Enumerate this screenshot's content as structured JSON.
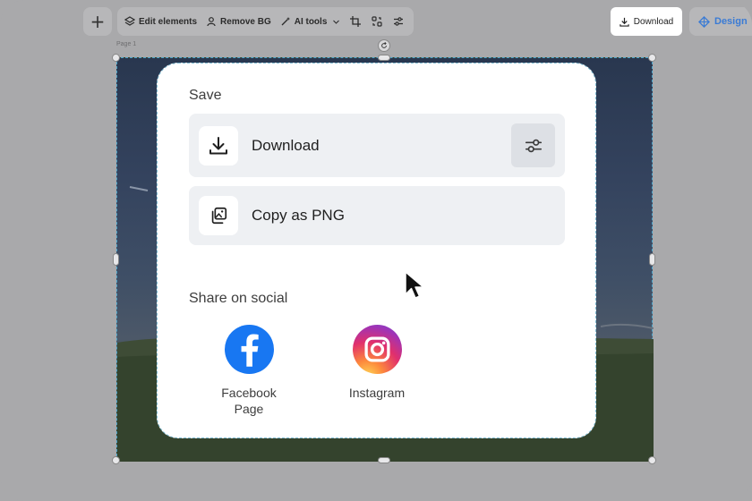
{
  "toolbar": {
    "add_label": "+",
    "edit_elements": "Edit elements",
    "remove_bg": "Remove BG",
    "ai_tools": "AI tools",
    "download": "Download",
    "design": "Design"
  },
  "canvas": {
    "page_label": "Page 1"
  },
  "popup": {
    "save_title": "Save",
    "download_label": "Download",
    "copy_label": "Copy as PNG",
    "share_title": "Share on social",
    "social": [
      {
        "label": "Facebook Page"
      },
      {
        "label": "Instagram"
      }
    ]
  },
  "colors": {
    "facebook": "#1877f2",
    "design_accent": "#3a7bd5",
    "selection": "#4aa3c9"
  }
}
